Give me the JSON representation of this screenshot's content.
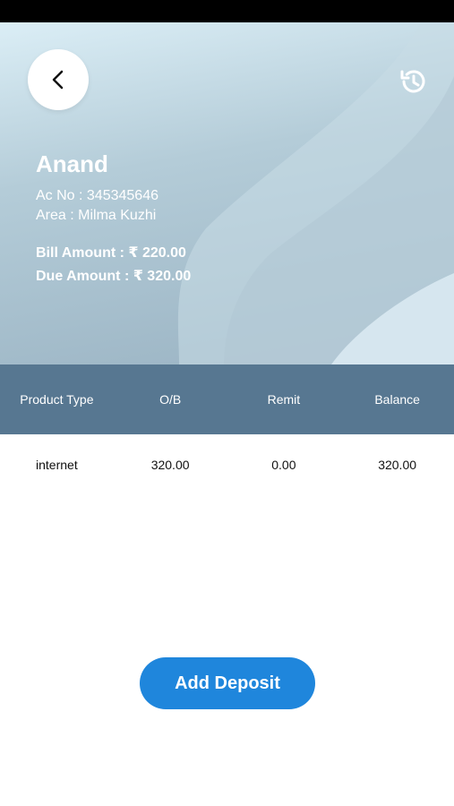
{
  "customer": {
    "name": "Anand",
    "account_no": "Ac No : 345345646",
    "area": "Area : Milma Kuzhi",
    "bill_amount": "Bill Amount : ₹ 220.00",
    "due_amount": "Due Amount : ₹ 320.00"
  },
  "table": {
    "headers": [
      "Product Type",
      "O/B",
      "Remit",
      "Balance"
    ],
    "rows": [
      [
        "internet",
        "320.00",
        "0.00",
        "320.00"
      ]
    ]
  },
  "actions": {
    "add_deposit_label": "Add Deposit"
  },
  "icons": {
    "back": "chevron-left-icon",
    "history": "history-icon"
  },
  "colors": {
    "table_header": "#577791",
    "primary_button": "#1f86dc"
  }
}
